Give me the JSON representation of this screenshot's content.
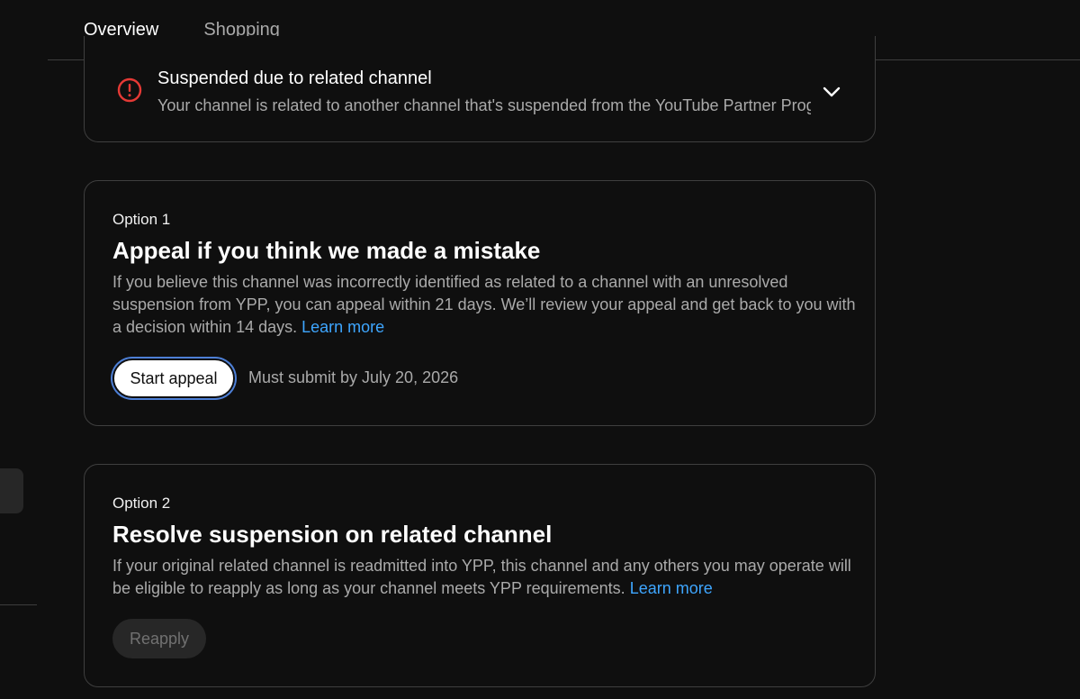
{
  "tabs": [
    {
      "label": "Overview",
      "active": true
    },
    {
      "label": "Shopping",
      "active": false
    }
  ],
  "status": {
    "icon": "error-circle-icon",
    "icon_color": "#e53935",
    "title": "Suspended due to related channel",
    "description": "Your channel is related to another channel that's suspended from the YouTube Partner Program"
  },
  "option1": {
    "label": "Option 1",
    "title": "Appeal if you think we made a mistake",
    "description": "If you believe this channel was incorrectly identified as related to a channel with an unresolved suspension from YPP, you can appeal within 21 days. We’ll review your appeal and get back to you with a decision within 14 days.",
    "learn_more": "Learn more",
    "button": "Start appeal",
    "deadline": "Must submit by July 20, 2026"
  },
  "option2": {
    "label": "Option 2",
    "title": "Resolve suspension on related channel",
    "description": "If your original related channel is readmitted into YPP, this channel and any others you may operate will be eligible to reapply as long as your channel meets YPP requirements.",
    "learn_more": "Learn more",
    "button": "Reapply"
  },
  "colors": {
    "background": "#0f0f0f",
    "link": "#3ea6ff",
    "error": "#e53935"
  }
}
